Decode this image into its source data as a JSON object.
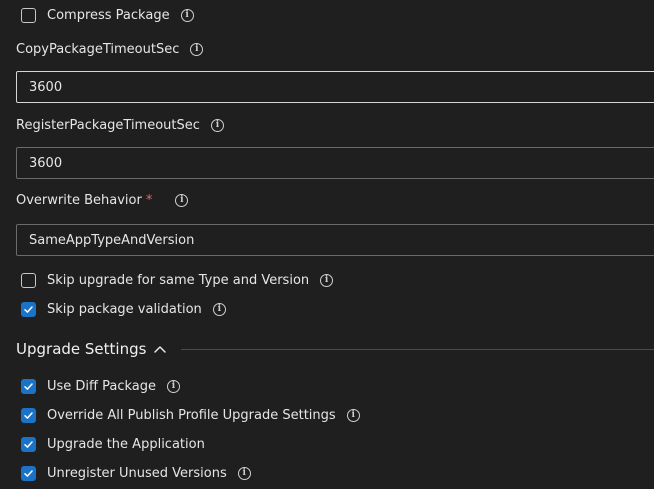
{
  "compress_package": {
    "label": "Compress Package",
    "checked": false
  },
  "copy_timeout": {
    "label": "CopyPackageTimeoutSec",
    "value": "3600"
  },
  "register_timeout": {
    "label": "RegisterPackageTimeoutSec",
    "value": "3600"
  },
  "overwrite_behavior": {
    "label": "Overwrite Behavior",
    "required_mark": "*",
    "value": "SameAppTypeAndVersion"
  },
  "skip_upgrade": {
    "label": "Skip upgrade for same Type and Version",
    "checked": false
  },
  "skip_validation": {
    "label": "Skip package validation",
    "checked": true
  },
  "upgrade_settings": {
    "title": "Upgrade Settings",
    "expanded": true,
    "use_diff": {
      "label": "Use Diff Package",
      "checked": true
    },
    "override_all": {
      "label": "Override All Publish Profile Upgrade Settings",
      "checked": true
    },
    "upgrade_app": {
      "label": "Upgrade the Application",
      "checked": true
    },
    "unregister": {
      "label": "Unregister Unused Versions",
      "checked": true
    }
  },
  "icons": {
    "info": "info-icon",
    "check": "check-icon",
    "collapse": "chevron-up-icon"
  },
  "colors": {
    "background": "#1f1f1f",
    "checkbox_checked": "#1a73c7",
    "required": "#e06b6b"
  }
}
